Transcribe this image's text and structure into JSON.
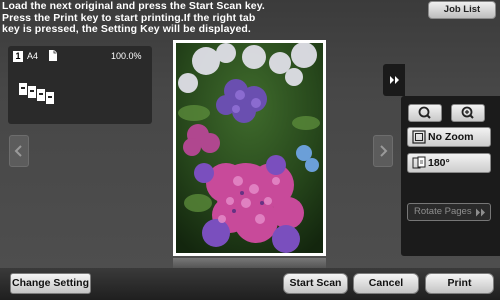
{
  "message": {
    "line1": "Load the next original and press the Start Scan key.",
    "line2": "Press the Print key to start printing.If the right tab",
    "line3": "key is pressed, the Setting Key will be displayed."
  },
  "header": {
    "job_list_label": "Job List"
  },
  "info_panel": {
    "page_number": "1",
    "paper_size": "A4",
    "zoom_value": "100.0%"
  },
  "preview": {
    "image_name": "hydrangea-preview",
    "zoom_level": "No Zoom",
    "rotation": "180°"
  },
  "side_panel": {
    "zoom_out_icon": "magnify-icon",
    "zoom_in_icon": "magnify-plus-icon",
    "no_zoom_label": "No Zoom",
    "rotate_label": "180°",
    "rotate_pages_label": "Rotate Pages"
  },
  "footer": {
    "change_setting_label": "Change Setting",
    "start_scan_label": "Start Scan",
    "cancel_label": "Cancel",
    "print_label": "Print"
  }
}
